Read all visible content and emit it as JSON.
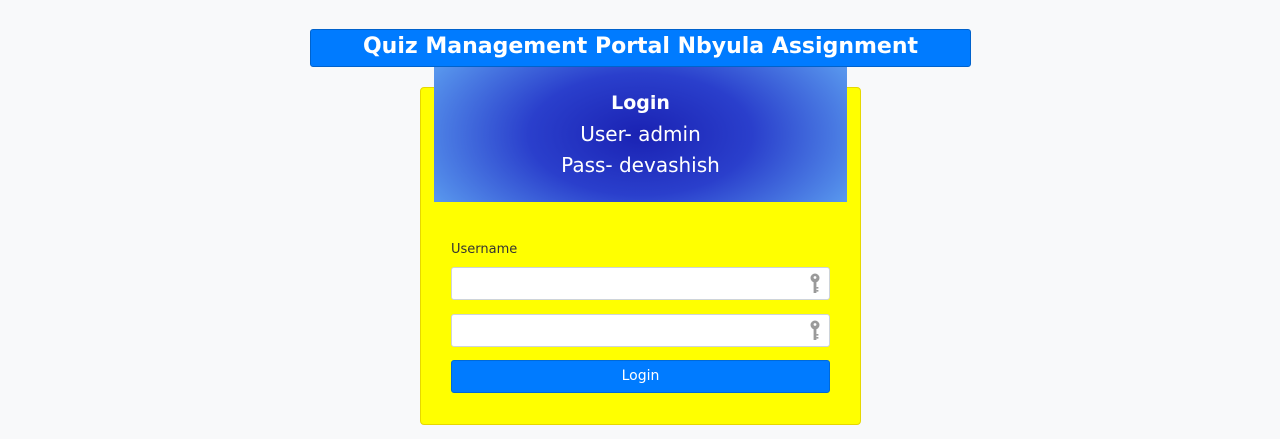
{
  "header": {
    "title": "Quiz Management Portal Nbyula Assignment"
  },
  "login_box": {
    "heading": "Login",
    "user_hint": "User- admin",
    "pass_hint": "Pass- devashish"
  },
  "form": {
    "username_label": "Username",
    "username_value": "",
    "password_value": "",
    "submit_label": "Login",
    "field_icon": "key-icon"
  },
  "colors": {
    "primary": "#007bff",
    "card_background": "#ffff00",
    "page_background": "#f8f9fa"
  }
}
